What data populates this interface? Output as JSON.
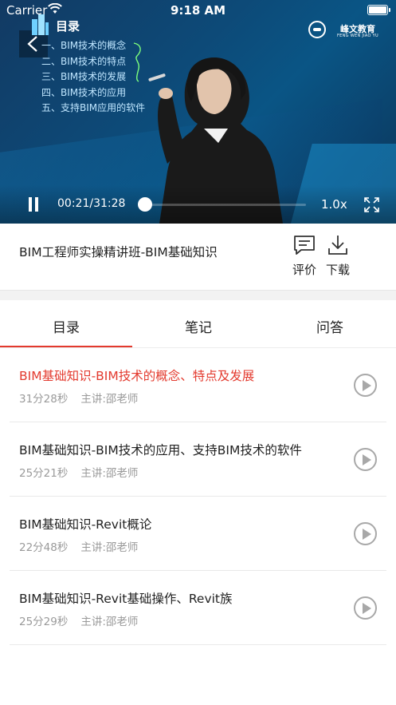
{
  "status": {
    "carrier": "Carrier",
    "time": "9:18 AM"
  },
  "player": {
    "toc_title": "目录",
    "toc_items": [
      "一、BIM技术的概念",
      "二、BIM技术的特点",
      "三、BIM技术的发展",
      "四、BIM技术的应用",
      "五、支持BIM应用的软件"
    ],
    "brand_name": "峰文教育",
    "brand_sub": "FENG WEN JIAO YU",
    "time_display": "00:21/31:28",
    "progress": 0.0,
    "speed": "1.0x"
  },
  "course": {
    "title": "BIM工程师实操精讲班-BIM基础知识",
    "rate_label": "评价",
    "download_label": "下载"
  },
  "tabs": [
    {
      "label": "目录",
      "active": true
    },
    {
      "label": "笔记",
      "active": false
    },
    {
      "label": "问答",
      "active": false
    }
  ],
  "lessons": [
    {
      "title": "BIM基础知识-BIM技术的概念、特点及发展",
      "duration": "31分28秒",
      "teacher": "主讲:邵老师",
      "active": true
    },
    {
      "title": "BIM基础知识-BIM技术的应用、支持BIM技术的软件",
      "duration": "25分21秒",
      "teacher": "主讲:邵老师",
      "active": false
    },
    {
      "title": "BIM基础知识-Revit概论",
      "duration": "22分48秒",
      "teacher": "主讲:邵老师",
      "active": false
    },
    {
      "title": "BIM基础知识-Revit基础操作、Revit族",
      "duration": "25分29秒",
      "teacher": "主讲:邵老师",
      "active": false
    }
  ],
  "colors": {
    "accent": "#e33a2e",
    "video_bg": "#0d4a78"
  },
  "icons": {
    "back": "chevron-left-icon",
    "toc": "building-icon",
    "pause": "pause-icon",
    "fullscreen": "expand-icon",
    "rate": "comment-icon",
    "download": "download-icon",
    "play": "play-circle-icon"
  }
}
